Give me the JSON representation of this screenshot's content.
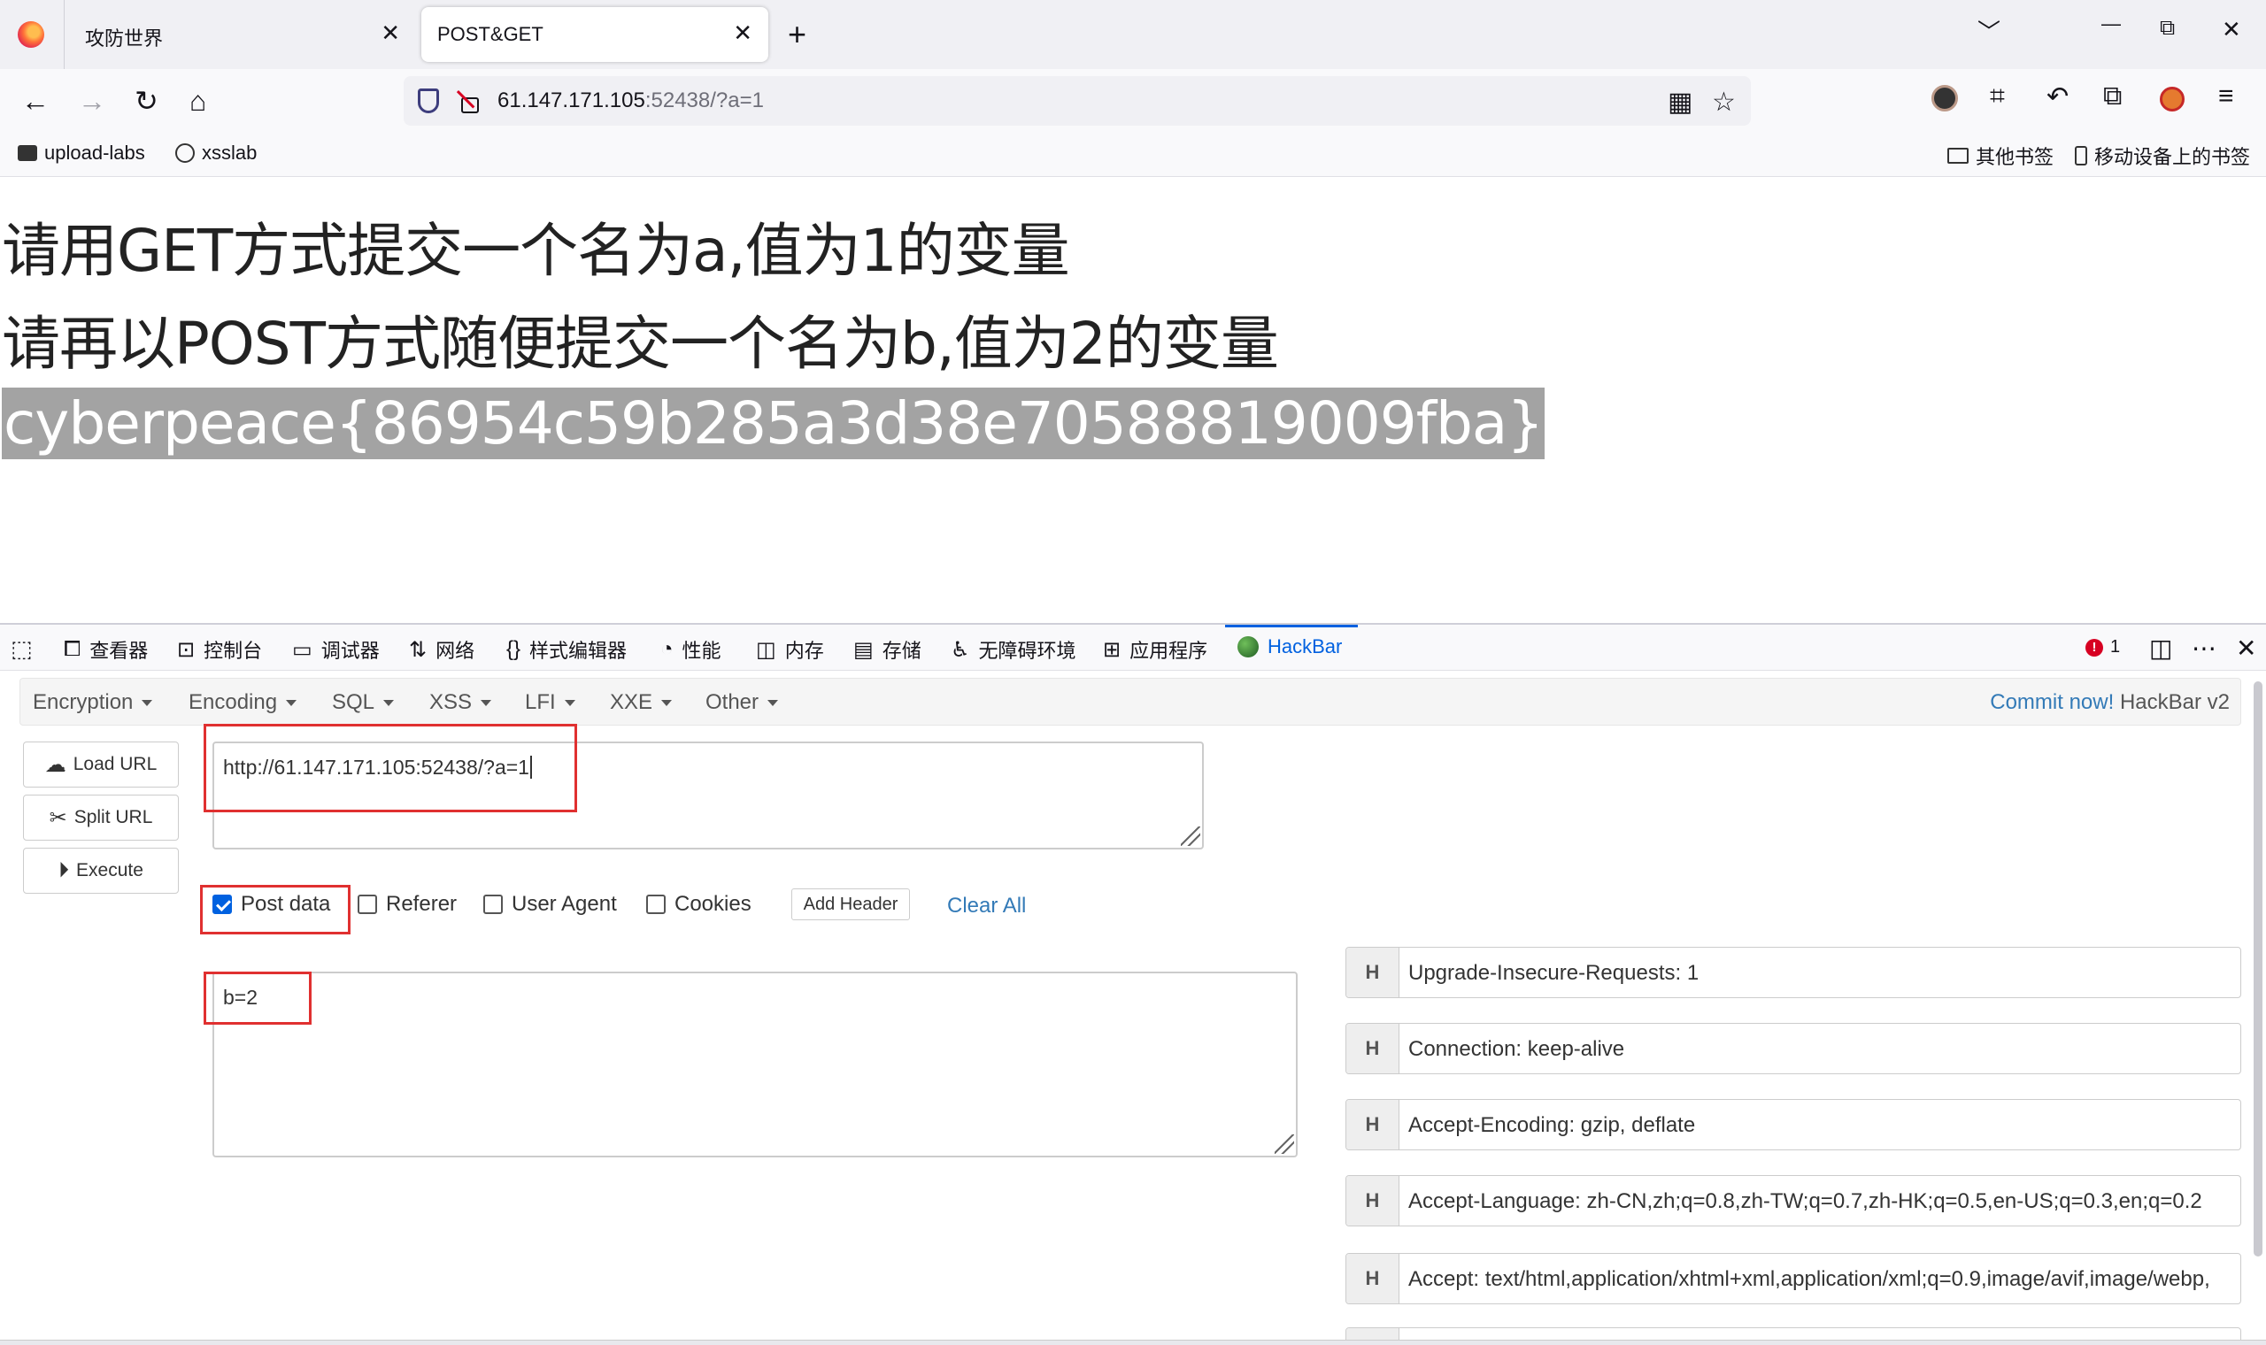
{
  "tabs": [
    {
      "title": "攻防世界",
      "close": "✕"
    },
    {
      "title": "POST&GET",
      "close": "✕"
    }
  ],
  "window": {
    "new_tab": "+",
    "list_all": "﹀",
    "minimize": "—",
    "restore": "⧉",
    "close": "✕"
  },
  "nav": {
    "back": "←",
    "forward": "→",
    "reload": "↻",
    "home": "⌂",
    "url_host": "61.147.171.105",
    "url_rest": ":52438/?a=1",
    "qr": "▦",
    "star": "☆",
    "toolbar_icons": [
      "avatar-icon",
      "crop-icon",
      "undo-icon",
      "extensions-icon",
      "blocker-icon",
      "menu-icon"
    ]
  },
  "bookmarks": {
    "left": [
      {
        "label": "upload-labs",
        "icon": "folder-icon"
      },
      {
        "label": "xsslab",
        "icon": "globe-icon"
      }
    ],
    "right": [
      {
        "label": "其他书签",
        "icon": "folder-icon"
      },
      {
        "label": "移动设备上的书签",
        "icon": "phone-icon"
      }
    ]
  },
  "page": {
    "line1": "请用GET方式提交一个名为a,值为1的变量",
    "line2": "请再以POST方式随便提交一个名为b,值为2的变量",
    "flag": "cyberpeace{86954c59b285a3d38e70588819009fba}"
  },
  "devtools": {
    "tabs": [
      {
        "label": "查看器",
        "icon": "⧠"
      },
      {
        "label": "控制台",
        "icon": "⊡"
      },
      {
        "label": "调试器",
        "icon": "▭"
      },
      {
        "label": "网络",
        "icon": "⇅"
      },
      {
        "label": "样式编辑器",
        "icon": "{}"
      },
      {
        "label": "性能",
        "icon": "◔"
      },
      {
        "label": "内存",
        "icon": "◫"
      },
      {
        "label": "存储",
        "icon": "▤"
      },
      {
        "label": "无障碍环境",
        "icon": "♿"
      },
      {
        "label": "应用程序",
        "icon": "⊞"
      },
      {
        "label": "HackBar",
        "icon": ""
      }
    ],
    "error_count": "1",
    "error_icon": "!"
  },
  "hackbar": {
    "menu": [
      "Encryption",
      "Encoding",
      "SQL",
      "XSS",
      "LFI",
      "XXE",
      "Other"
    ],
    "commit_link": "Commit now!",
    "commit_version": "HackBar v2",
    "buttons": {
      "load": "Load URL",
      "split": "Split URL",
      "execute": "Execute"
    },
    "url_value": "http://61.147.171.105:52438/?a=1",
    "checks": {
      "post": "Post data",
      "referer": "Referer",
      "ua": "User Agent",
      "cookies": "Cookies"
    },
    "post_checked": true,
    "add_header": "Add Header",
    "clear_all": "Clear All",
    "post_value": "b=2",
    "header_marker": "H",
    "headers": [
      "Upgrade-Insecure-Requests: 1",
      "Connection: keep-alive",
      "Accept-Encoding: gzip, deflate",
      "Accept-Language: zh-CN,zh;q=0.8,zh-TW;q=0.7,zh-HK;q=0.5,en-US;q=0.3,en;q=0.2",
      "Accept: text/html,application/xhtml+xml,application/xml;q=0.9,image/avif,image/webp,"
    ]
  }
}
